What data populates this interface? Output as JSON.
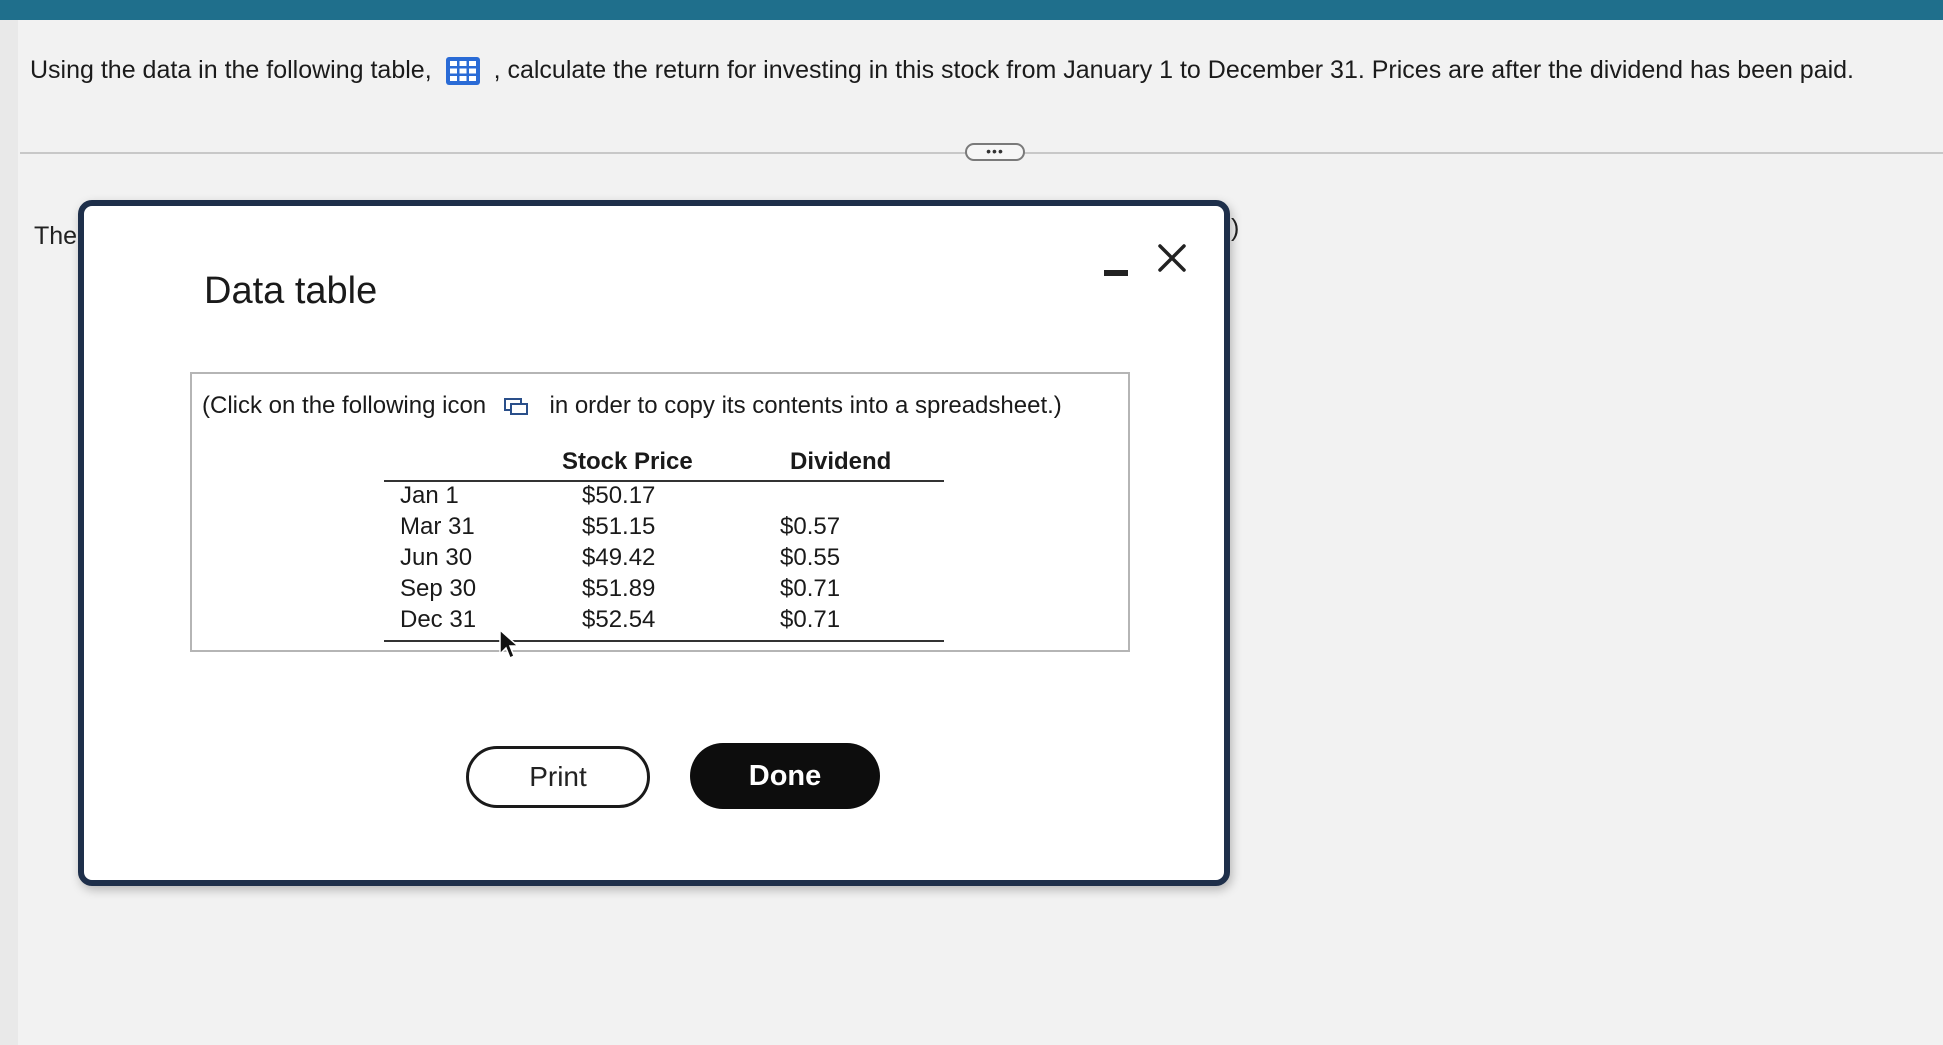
{
  "question": {
    "text_before": "Using the data in the following table,",
    "table_icon": "grid-table-icon",
    "text_after": ", calculate the return for investing in this stock from January 1 to December 31. Prices are after the dividend has been paid."
  },
  "expand_button": {
    "label": "•••"
  },
  "background_text": {
    "left_fragment": "The",
    "right_fragment": ".)"
  },
  "dialog": {
    "title": "Data table",
    "instruction_before": "(Click on the following icon",
    "copy_icon": "copy-to-spreadsheet-icon",
    "instruction_after": "in order to copy its contents into a spreadsheet.)",
    "table": {
      "headers": {
        "date": "",
        "price": "Stock Price",
        "dividend": "Dividend"
      },
      "rows": [
        {
          "date": "Jan 1",
          "price": "$50.17",
          "dividend": ""
        },
        {
          "date": "Mar 31",
          "price": "$51.15",
          "dividend": "$0.57"
        },
        {
          "date": "Jun 30",
          "price": "$49.42",
          "dividend": "$0.55"
        },
        {
          "date": "Sep 30",
          "price": "$51.89",
          "dividend": "$0.71"
        },
        {
          "date": "Dec 31",
          "price": "$52.54",
          "dividend": "$0.71"
        }
      ]
    },
    "print_label": "Print",
    "done_label": "Done",
    "minimize_icon": "minimize-icon",
    "close_icon": "close-icon"
  },
  "colors": {
    "top_bar": "#1f6f8c",
    "dialog_border": "#1e2f4a",
    "table_icon": "#2a6bd6",
    "done_button": "#0d0d0d"
  }
}
